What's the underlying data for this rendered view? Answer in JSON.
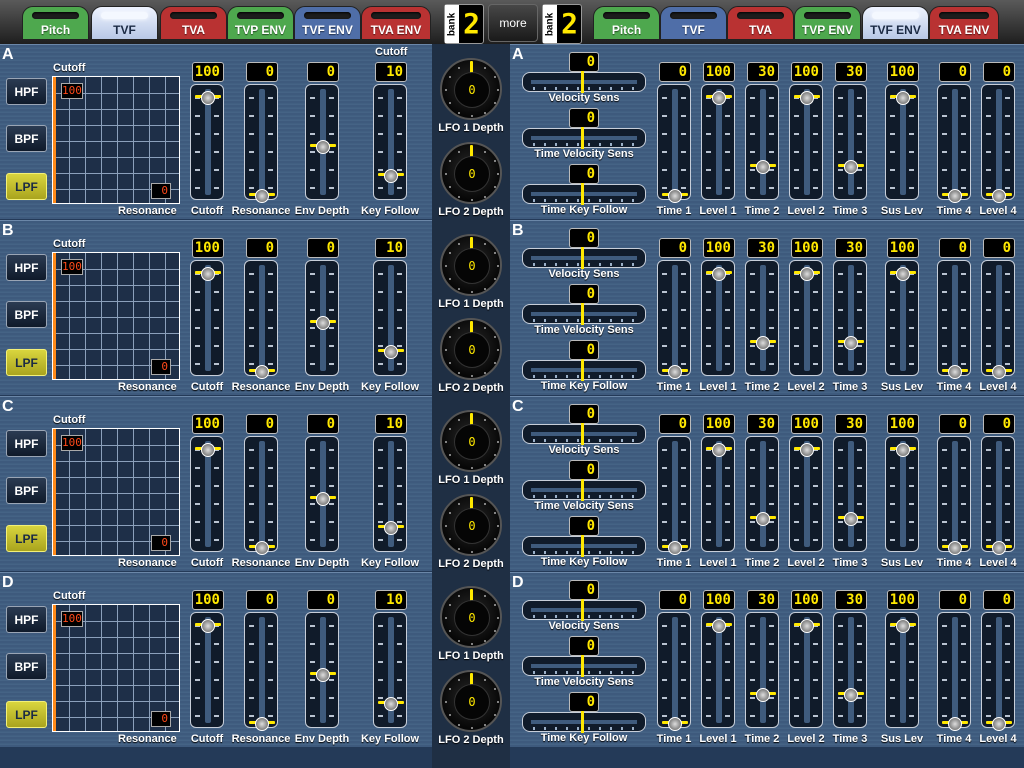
{
  "tabs_left": [
    {
      "label": "Pitch",
      "color": "#4ea84e",
      "selected": false
    },
    {
      "label": "TVF",
      "color": "#4f6ea8",
      "selected": true
    },
    {
      "label": "TVA",
      "color": "#b93232",
      "selected": false
    },
    {
      "label": "TVP ENV",
      "color": "#4ea84e",
      "selected": false
    },
    {
      "label": "TVF ENV",
      "color": "#4f6ea8",
      "selected": false
    },
    {
      "label": "TVA ENV",
      "color": "#b93232",
      "selected": false
    }
  ],
  "tabs_right": [
    {
      "label": "Pitch",
      "color": "#4ea84e",
      "selected": false
    },
    {
      "label": "TVF",
      "color": "#4f6ea8",
      "selected": false
    },
    {
      "label": "TVA",
      "color": "#b93232",
      "selected": false
    },
    {
      "label": "TVP ENV",
      "color": "#4ea84e",
      "selected": false
    },
    {
      "label": "TVF ENV",
      "color": "#4f6ea8",
      "selected": true
    },
    {
      "label": "TVA ENV",
      "color": "#b93232",
      "selected": false
    }
  ],
  "bank_left": {
    "label": "bank",
    "value": "2"
  },
  "bank_right": {
    "label": "bank",
    "value": "2"
  },
  "more_label": "more",
  "filter_buttons": [
    "HPF",
    "BPF",
    "LPF"
  ],
  "grid_labels": {
    "cutoff": "Cutoff",
    "resonance": "Resonance"
  },
  "slider_labels_tvf": [
    "Cutoff",
    "Resonance",
    "Env Depth",
    "Key Follow"
  ],
  "lfo_labels": [
    "LFO 1 Depth",
    "LFO 2 Depth"
  ],
  "velocity_labels": [
    "Velocity Sens",
    "Time Velocity Sens",
    "Time Key Follow"
  ],
  "env_labels": [
    "Time 1",
    "Level 1",
    "Time 2",
    "Level 2",
    "Time 3",
    "Sus Lev",
    "Time 4",
    "Level 4"
  ],
  "rows": [
    {
      "letter": "A",
      "cutoff_led": "100",
      "resonance_led": "0",
      "tvf": [
        "100",
        "0",
        "0",
        "10"
      ],
      "tvf_pos": [
        1.0,
        0.0,
        0.5,
        0.2
      ],
      "key_follow_header": "Cutoff",
      "lfo": [
        "0",
        "0"
      ],
      "velocity": [
        "0",
        "0",
        "0"
      ],
      "env": [
        "0",
        "100",
        "30",
        "100",
        "30",
        "100",
        "0",
        "0"
      ],
      "env_pos": [
        0.0,
        1.0,
        0.3,
        1.0,
        0.3,
        1.0,
        0.0,
        0.0
      ]
    },
    {
      "letter": "B",
      "cutoff_led": "100",
      "resonance_led": "0",
      "tvf": [
        "100",
        "0",
        "0",
        "10"
      ],
      "tvf_pos": [
        1.0,
        0.0,
        0.5,
        0.2
      ],
      "key_follow_header": "",
      "lfo": [
        "0",
        "0"
      ],
      "velocity": [
        "0",
        "0",
        "0"
      ],
      "env": [
        "0",
        "100",
        "30",
        "100",
        "30",
        "100",
        "0",
        "0"
      ],
      "env_pos": [
        0.0,
        1.0,
        0.3,
        1.0,
        0.3,
        1.0,
        0.0,
        0.0
      ]
    },
    {
      "letter": "C",
      "cutoff_led": "100",
      "resonance_led": "0",
      "tvf": [
        "100",
        "0",
        "0",
        "10"
      ],
      "tvf_pos": [
        1.0,
        0.0,
        0.5,
        0.2
      ],
      "key_follow_header": "",
      "lfo": [
        "0",
        "0"
      ],
      "velocity": [
        "0",
        "0",
        "0"
      ],
      "env": [
        "0",
        "100",
        "30",
        "100",
        "30",
        "100",
        "0",
        "0"
      ],
      "env_pos": [
        0.0,
        1.0,
        0.3,
        1.0,
        0.3,
        1.0,
        0.0,
        0.0
      ]
    },
    {
      "letter": "D",
      "cutoff_led": "100",
      "resonance_led": "0",
      "tvf": [
        "100",
        "0",
        "0",
        "10"
      ],
      "tvf_pos": [
        1.0,
        0.0,
        0.5,
        0.2
      ],
      "key_follow_header": "",
      "lfo": [
        "0",
        "0"
      ],
      "velocity": [
        "0",
        "0",
        "0"
      ],
      "env": [
        "0",
        "100",
        "30",
        "100",
        "30",
        "100",
        "0",
        "0"
      ],
      "env_pos": [
        0.0,
        1.0,
        0.3,
        1.0,
        0.3,
        1.0,
        0.0,
        0.0
      ]
    }
  ]
}
